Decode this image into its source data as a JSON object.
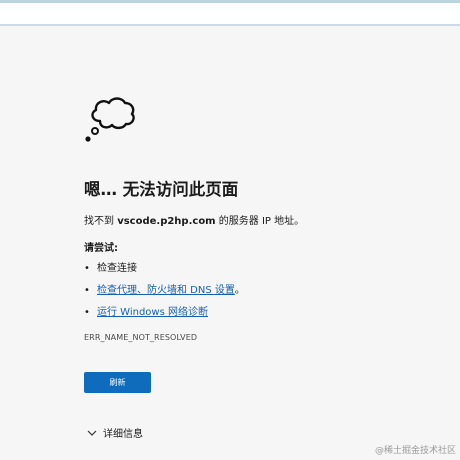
{
  "page": {
    "title": "嗯… 无法访问此页面",
    "description_prefix": "找不到 ",
    "host": "vscode.p2hp.com",
    "description_suffix": " 的服务器 IP 地址。",
    "try_label": "请尝试:",
    "suggestions": [
      {
        "text": "检查连接",
        "link": false
      },
      {
        "text": "检查代理、防火墙和 DNS 设置",
        "link": true,
        "suffix": "。"
      },
      {
        "text": "运行 Windows 网络诊断",
        "link": true,
        "suffix": ""
      }
    ],
    "error_code": "ERR_NAME_NOT_RESOLVED",
    "refresh_label": "刷新",
    "details_label": "详细信息",
    "bullet": "•"
  },
  "icons": {
    "error_illustration": "thought-cloud-icon",
    "details_toggle": "chevron-down-icon"
  },
  "colors": {
    "accent": "#0f6cbd",
    "link": "#1760b0",
    "background": "#f6f6f6"
  },
  "watermark": "@稀土掘金技术社区"
}
